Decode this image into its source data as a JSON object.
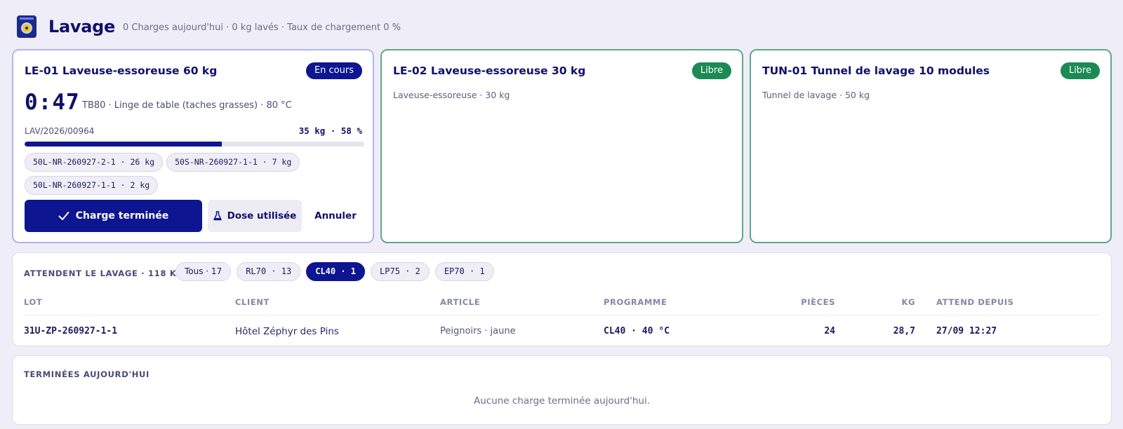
{
  "header": {
    "title": "Lavage",
    "stats": "0 Charges aujourd'hui · 0 kg lavés · Taux de chargement 0 %"
  },
  "machines": [
    {
      "title": "LE-01 Laveuse-essoreuse 60 kg",
      "status": "En cours",
      "timer": "0:47",
      "program_info": "TB80 · Linge de table (taches grasses) · 80 °C",
      "batch_id": "LAV/2026/00964",
      "load_info": "35 kg · 58 %",
      "load_fraction": 0.58,
      "chips": [
        "50L-NR-260927-2-1 · 26 kg",
        "50S-NR-260927-1-1 · 7 kg",
        "50L-NR-260927-1-1 · 2 kg"
      ],
      "btn_done": "Charge terminée",
      "btn_dose": "Dose utilisée",
      "btn_cancel": "Annuler"
    },
    {
      "title": "LE-02 Laveuse-essoreuse 30 kg",
      "status": "Libre",
      "subtitle": "Laveuse-essoreuse · 30 kg"
    },
    {
      "title": "TUN-01 Tunnel de lavage 10 modules",
      "status": "Libre",
      "subtitle": "Tunnel de lavage · 50 kg"
    }
  ],
  "queue": {
    "label": "ATTENDENT LE LAVAGE · 118 KG",
    "filters": [
      "Tous · 17",
      "RL70 · 13",
      "CL40 · 1",
      "LP75 · 2",
      "EP70 · 1"
    ],
    "active_filter": "CL40 · 1",
    "columns": {
      "lot": "LOT",
      "client": "CLIENT",
      "article": "ARTICLE",
      "programme": "PROGRAMME",
      "pieces": "PIÈCES",
      "kg": "KG",
      "waiting": "ATTEND DEPUIS"
    },
    "rows": [
      {
        "lot": "31U-ZP-260927-1-1",
        "client": "Hôtel Zéphyr des Pins",
        "article": "Peignoirs · jaune",
        "programme": "CL40 · 40 °C",
        "pieces": "24",
        "kg": "28,7",
        "waiting": "27/09 12:27"
      }
    ]
  },
  "completed": {
    "label": "TERMINÉES AUJOURD'HUI",
    "empty_message": "Aucune charge terminée aujourd'hui."
  },
  "colors": {
    "primary": "#0d1591",
    "free_badge": "#1c8a55",
    "running_border": "#aeb7ec",
    "free_border": "#5ca98a",
    "background": "#efedf7"
  }
}
